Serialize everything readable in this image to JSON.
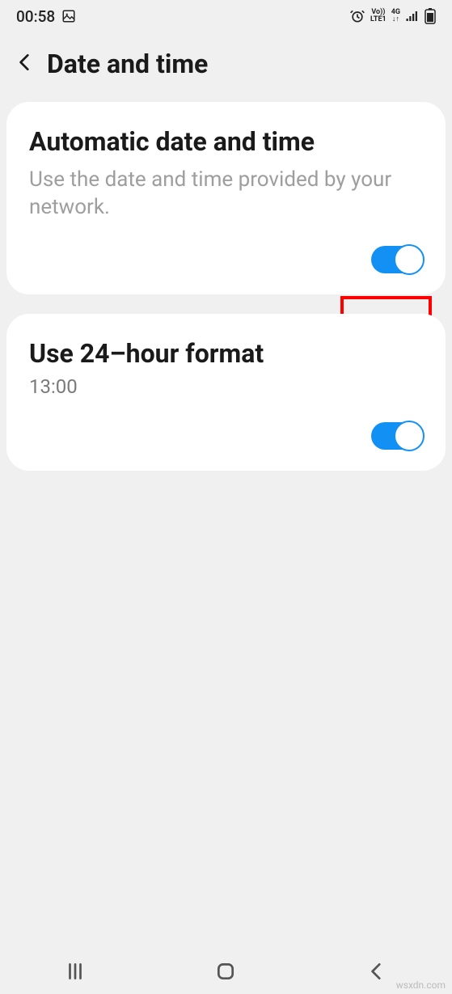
{
  "status": {
    "time": "00:58",
    "volte_top": "Vo))",
    "volte_bottom": "LTE1",
    "network": "4G"
  },
  "header": {
    "title": "Date and time"
  },
  "settings": {
    "auto": {
      "title": "Automatic date and time",
      "description": "Use the date and time provided by your network.",
      "on": true
    },
    "format24": {
      "title": "Use 24–hour format",
      "example": "13:00",
      "on": true
    }
  },
  "watermark": "wsxdn.com"
}
